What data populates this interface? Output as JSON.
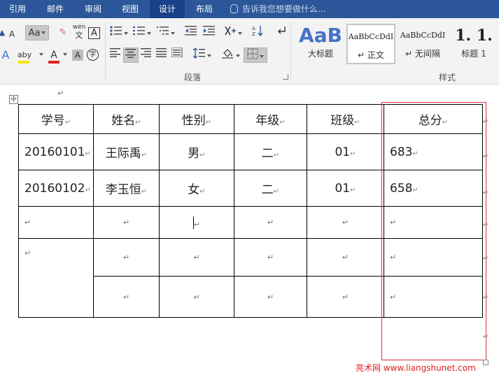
{
  "tabs": [
    "引用",
    "邮件",
    "审阅",
    "视图",
    "设计",
    "布局"
  ],
  "active_tab": "设计",
  "tell_me": {
    "placeholder": "告诉我您想要做什么..."
  },
  "ribbon": {
    "font_row1": {
      "superscript_a": "A",
      "subscript_a": "A",
      "change_case": "Aa",
      "eraser": "✎",
      "phonetic_top": "wén",
      "phonetic_bottom": "文",
      "char_border": "A"
    },
    "font_row2": {
      "text_effects": "A",
      "highlight": "aby",
      "font_color": "A",
      "char_shading": "A",
      "enclose": "字"
    },
    "paragraph_group_label": "段落",
    "styles_group_label": "样式",
    "colors": {
      "highlight_yellow": "#f5e60a",
      "font_red": "#e02020",
      "accent_blue": "#2b579a"
    },
    "styles": [
      {
        "sample": "AaB",
        "name": "大标题"
      },
      {
        "sample": "AaBbCcDdI",
        "name": "↵ 正文"
      },
      {
        "sample": "AaBbCcDdI",
        "name": "↵ 无间隔"
      },
      {
        "sample": "1. 1.",
        "name": "标题 1"
      }
    ]
  },
  "doc": {
    "para_mark": "↵",
    "table": {
      "headers": [
        "学号",
        "姓名",
        "性别",
        "年级",
        "班级",
        "总分"
      ],
      "rows": [
        [
          "20160101",
          "王际禹",
          "男",
          "二",
          "01",
          "683"
        ],
        [
          "20160102",
          "李玉恒",
          "女",
          "二",
          "01",
          "658"
        ]
      ],
      "empty_mark": "↵",
      "edge_mark": "↵"
    }
  },
  "watermark": "亮术网 www.liangshunet.com"
}
